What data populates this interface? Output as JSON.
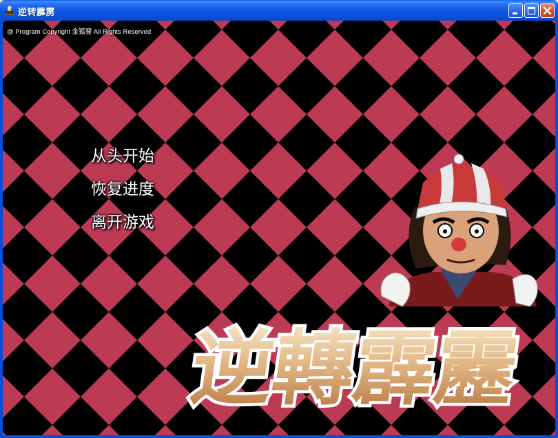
{
  "window": {
    "title": "逆转霹雳"
  },
  "copyright": "@ Program Copyright 金狐狸 All Rights Reserved",
  "menu": {
    "items": [
      "从头开始",
      "恢复进度",
      "离开游戏"
    ]
  },
  "logo_text": "逆轉霹靂",
  "colors": {
    "checker_light": "#bd3a55",
    "checker_dark": "#000000",
    "titlebar": "#0a54e3"
  }
}
